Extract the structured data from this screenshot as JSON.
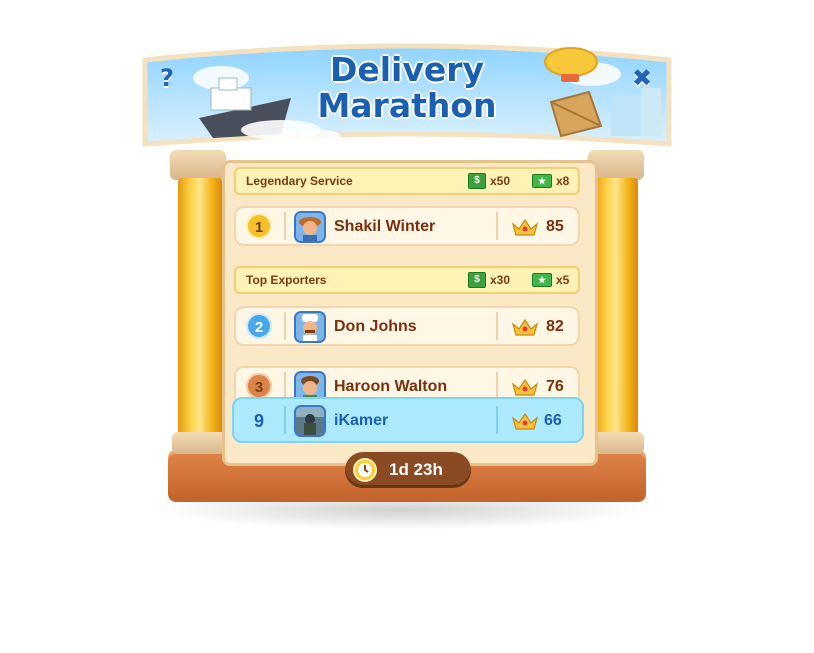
{
  "header": {
    "title_line1": "Delivery",
    "title_line2": "Marathon",
    "help_icon": "question-mark-icon",
    "close_icon": "close-x-icon"
  },
  "tiers": [
    {
      "label": "Legendary Service",
      "reward_cash": "x50",
      "reward_tickets": "x8",
      "players": [
        {
          "rank": "1",
          "name": "Shakil Winter",
          "score": "85",
          "medal_color": "#f4c02c"
        }
      ]
    },
    {
      "label": "Top Exporters",
      "reward_cash": "x30",
      "reward_tickets": "x5",
      "players": [
        {
          "rank": "2",
          "name": "Don Johns",
          "score": "82",
          "medal_color": "#4aa8e8"
        },
        {
          "rank": "3",
          "name": "Haroon Walton",
          "score": "76",
          "medal_color": "#d8844a"
        }
      ]
    }
  ],
  "current_player": {
    "rank": "9",
    "name": "iKamer",
    "score": "66"
  },
  "timer": {
    "text": "1d 23h",
    "icon": "clock-icon"
  },
  "colors": {
    "title": "#1a5fb0",
    "text_brown": "#7a3010",
    "highlight_row": "#aeeaff",
    "board": "#fbe8c6"
  }
}
